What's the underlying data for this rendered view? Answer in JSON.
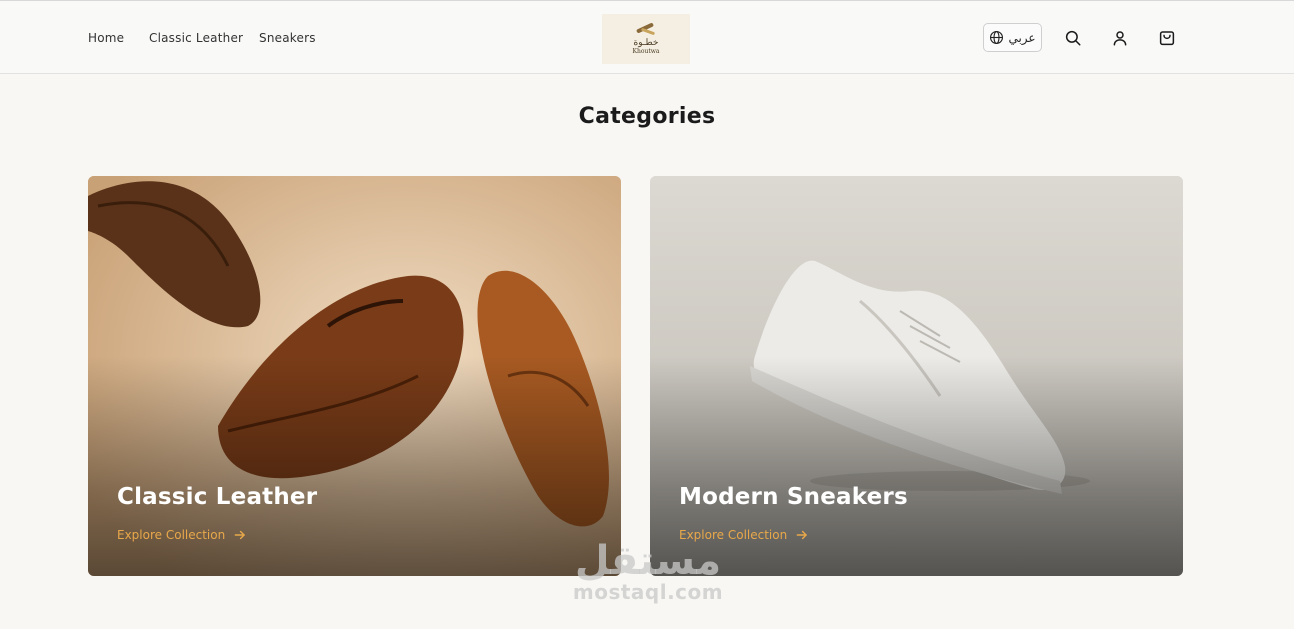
{
  "nav": {
    "items": [
      {
        "label": "Home"
      },
      {
        "label": "Classic Leather"
      },
      {
        "label": "Sneakers"
      }
    ]
  },
  "logo": {
    "arabic": "خطـوة",
    "english": "Khoutwa"
  },
  "header_actions": {
    "language_label": "عربي",
    "icons": [
      "globe-icon",
      "search-icon",
      "user-icon",
      "cart-icon"
    ]
  },
  "page": {
    "title": "Categories"
  },
  "categories": [
    {
      "title": "Classic Leather",
      "link_label": "Explore Collection"
    },
    {
      "title": "Modern Sneakers",
      "link_label": "Explore Collection"
    }
  ],
  "watermark": {
    "arabic": "مستقل",
    "english": "mostaql.com"
  },
  "colors": {
    "accent": "#e8a84a",
    "background": "#f8f7f4",
    "text": "#1b1b1b"
  }
}
